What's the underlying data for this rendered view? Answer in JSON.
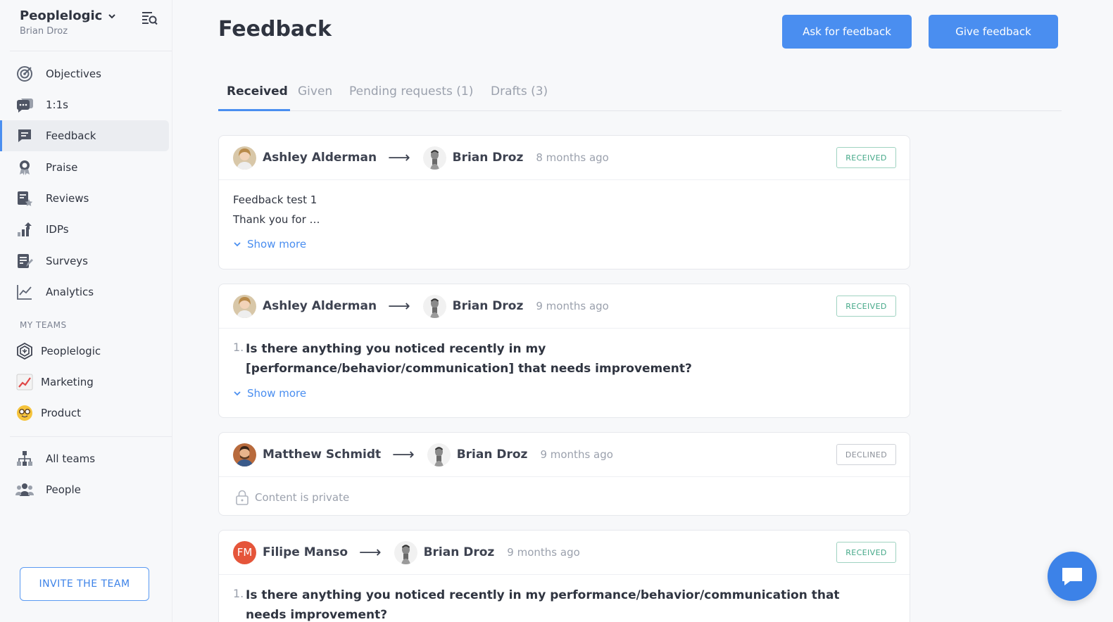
{
  "workspace": {
    "name": "Peoplelogic",
    "user": "Brian Droz"
  },
  "nav": [
    {
      "label": "Objectives",
      "icon": "target-icon"
    },
    {
      "label": "1:1s",
      "icon": "chat-icon"
    },
    {
      "label": "Feedback",
      "icon": "feedback-icon",
      "active": true
    },
    {
      "label": "Praise",
      "icon": "award-icon"
    },
    {
      "label": "Reviews",
      "icon": "review-icon"
    },
    {
      "label": "IDPs",
      "icon": "growth-chart-icon"
    },
    {
      "label": "Surveys",
      "icon": "survey-icon"
    },
    {
      "label": "Analytics",
      "icon": "line-chart-icon"
    }
  ],
  "teams_section_label": "MY TEAMS",
  "teams": [
    {
      "label": "Peoplelogic",
      "icon": "peoplelogic-logo-icon"
    },
    {
      "label": "Marketing",
      "icon": "chart-emoji-icon"
    },
    {
      "label": "Product",
      "icon": "nerd-face-emoji-icon"
    }
  ],
  "bottom_nav": [
    {
      "label": "All teams",
      "icon": "org-chart-icon"
    },
    {
      "label": "People",
      "icon": "people-icon"
    }
  ],
  "invite_label": "INVITE THE TEAM",
  "page_title": "Feedback",
  "actions": {
    "ask": "Ask for feedback",
    "give": "Give feedback"
  },
  "tabs": [
    {
      "label": "Received",
      "active": true
    },
    {
      "label": "Given"
    },
    {
      "label": "Pending requests (1)"
    },
    {
      "label": "Drafts (3)"
    }
  ],
  "show_more_label": "Show more",
  "feedback": [
    {
      "from": "Ashley Alderman",
      "to": "Brian Droz",
      "time": "8 months ago",
      "status": "RECEIVED",
      "lines": [
        "Feedback test 1",
        "Thank you for …"
      ]
    },
    {
      "from": "Ashley Alderman",
      "to": "Brian Droz",
      "time": "9 months ago",
      "status": "RECEIVED",
      "question_num": "1.",
      "question": "Is there anything you noticed recently in my [performance/behavior/communication] that needs improvement?"
    },
    {
      "from": "Matthew Schmidt",
      "to": "Brian Droz",
      "time": "9 months ago",
      "status": "DECLINED",
      "private_text": "Content is private"
    },
    {
      "from": "Filipe Manso",
      "from_initials": "FM",
      "to": "Brian Droz",
      "time": "9 months ago",
      "status": "RECEIVED",
      "question_num": "1.",
      "question": "Is there anything you noticed recently in my performance/behavior/communication that needs improvement?"
    }
  ],
  "colors": {
    "accent": "#4a8ef0",
    "received": "#44a888",
    "declined": "#8a8f98"
  }
}
